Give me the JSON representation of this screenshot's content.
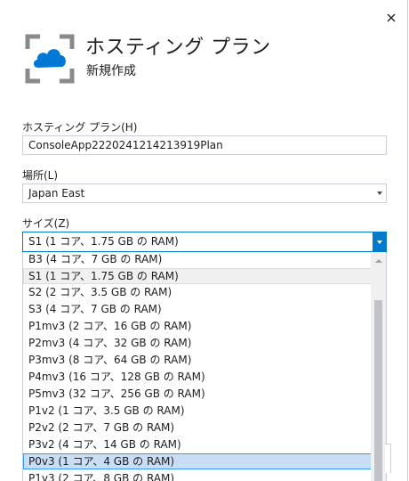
{
  "dialog": {
    "title": "ホスティング プラン",
    "subtitle": "新規作成"
  },
  "form": {
    "hosting_plan_label": "ホスティング プラン(H)",
    "hosting_plan_value": "ConsoleApp2220241214213919Plan",
    "location_label": "場所(L)",
    "location_value": "Japan East",
    "size_label": "サイズ(Z)",
    "size_value": "S1 (1 コア、1.75 GB の RAM)"
  },
  "size_options": [
    "B3 (4 コア、7 GB の RAM)",
    "S1 (1 コア、1.75 GB の RAM)",
    "S2 (2 コア、3.5 GB の RAM)",
    "S3 (4 コア、7 GB の RAM)",
    "P1mv3 (2 コア、16 GB の RAM)",
    "P2mv3 (4 コア、32 GB の RAM)",
    "P3mv3 (8 コア、64 GB の RAM)",
    "P4mv3 (16 コア、128 GB の RAM)",
    "P5mv3 (32 コア、256 GB の RAM)",
    "P1v2 (1 コア、3.5 GB の RAM)",
    "P2v2 (2 コア、7 GB の RAM)",
    "P3v2 (4 コア、14 GB の RAM)",
    "P0v3 (1 コア、4 GB の RAM)",
    "P1v3 (2 コア、8 GB の RAM)"
  ],
  "icons": {
    "close": "close-icon",
    "header": "azure-app-service-plan-icon"
  },
  "colors": {
    "accent": "#007acc",
    "icon_blue": "#0078d4",
    "icon_gray": "#8a8a8a"
  }
}
